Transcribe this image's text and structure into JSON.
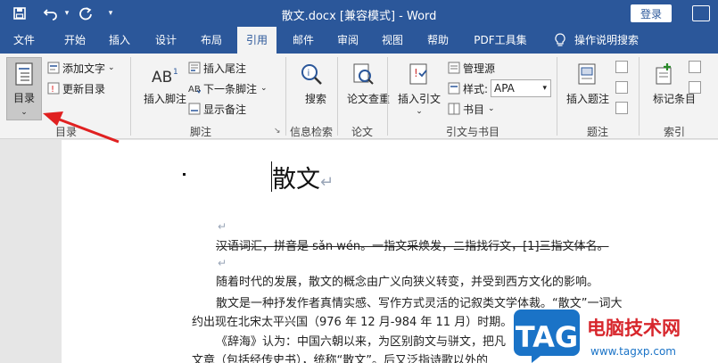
{
  "window": {
    "title": "散文.docx [兼容模式] - Word",
    "login": "登录"
  },
  "tabs": [
    "文件",
    "开始",
    "插入",
    "设计",
    "布局",
    "引用",
    "邮件",
    "审阅",
    "视图",
    "帮助",
    "PDF工具集",
    "操作说明搜索"
  ],
  "ribbon": {
    "toc": {
      "big": "目录",
      "add_text": "添加文字",
      "update": "更新目录",
      "group": "目录"
    },
    "footnote": {
      "insert": "插入脚注",
      "insert_end": "插入尾注",
      "next": "下一条脚注",
      "show": "显示备注",
      "group": "脚注"
    },
    "search": {
      "label": "搜索",
      "group": "信息检索"
    },
    "paper": {
      "label": "论文查重",
      "group": "论文"
    },
    "citation": {
      "insert": "插入引文",
      "manage": "管理源",
      "style_label": "样式:",
      "style_value": "APA",
      "bib": "书目",
      "group": "引文与书目"
    },
    "caption": {
      "insert": "插入题注",
      "group": "题注"
    },
    "index": {
      "mark": "标记条目",
      "group": "索引"
    }
  },
  "document": {
    "heading": "散文",
    "line1": "汉语词汇，拼音是 sǎn wén。一指文采焕发，二指找行文，[1]三指文体名。",
    "line2": "随着时代的发展，散文的概念由广义向狭义转变，并受到西方文化的影响。",
    "line3": "散文是一种抒发作者真情实感、写作方式灵活的记叙类文学体裁。“散文”一词大",
    "line4": "约出现在北宋太平兴国（976 年 12 月-984 年 11 月）时期。",
    "line5": "《辞海》认为：中国六朝以来，为区别韵文与骈文，把凡",
    "line6": "文章（包括经传史书），统称“散文”。后又泛指诗歌以外的",
    "para_mark": "↵"
  },
  "watermark": {
    "tag": "TAG",
    "site_name": "电脑技术网",
    "url": "www.tagxp.com"
  },
  "colors": {
    "word_blue": "#2b579a",
    "arrow_red": "#e02020",
    "watermark_blue": "#1a73c7"
  }
}
